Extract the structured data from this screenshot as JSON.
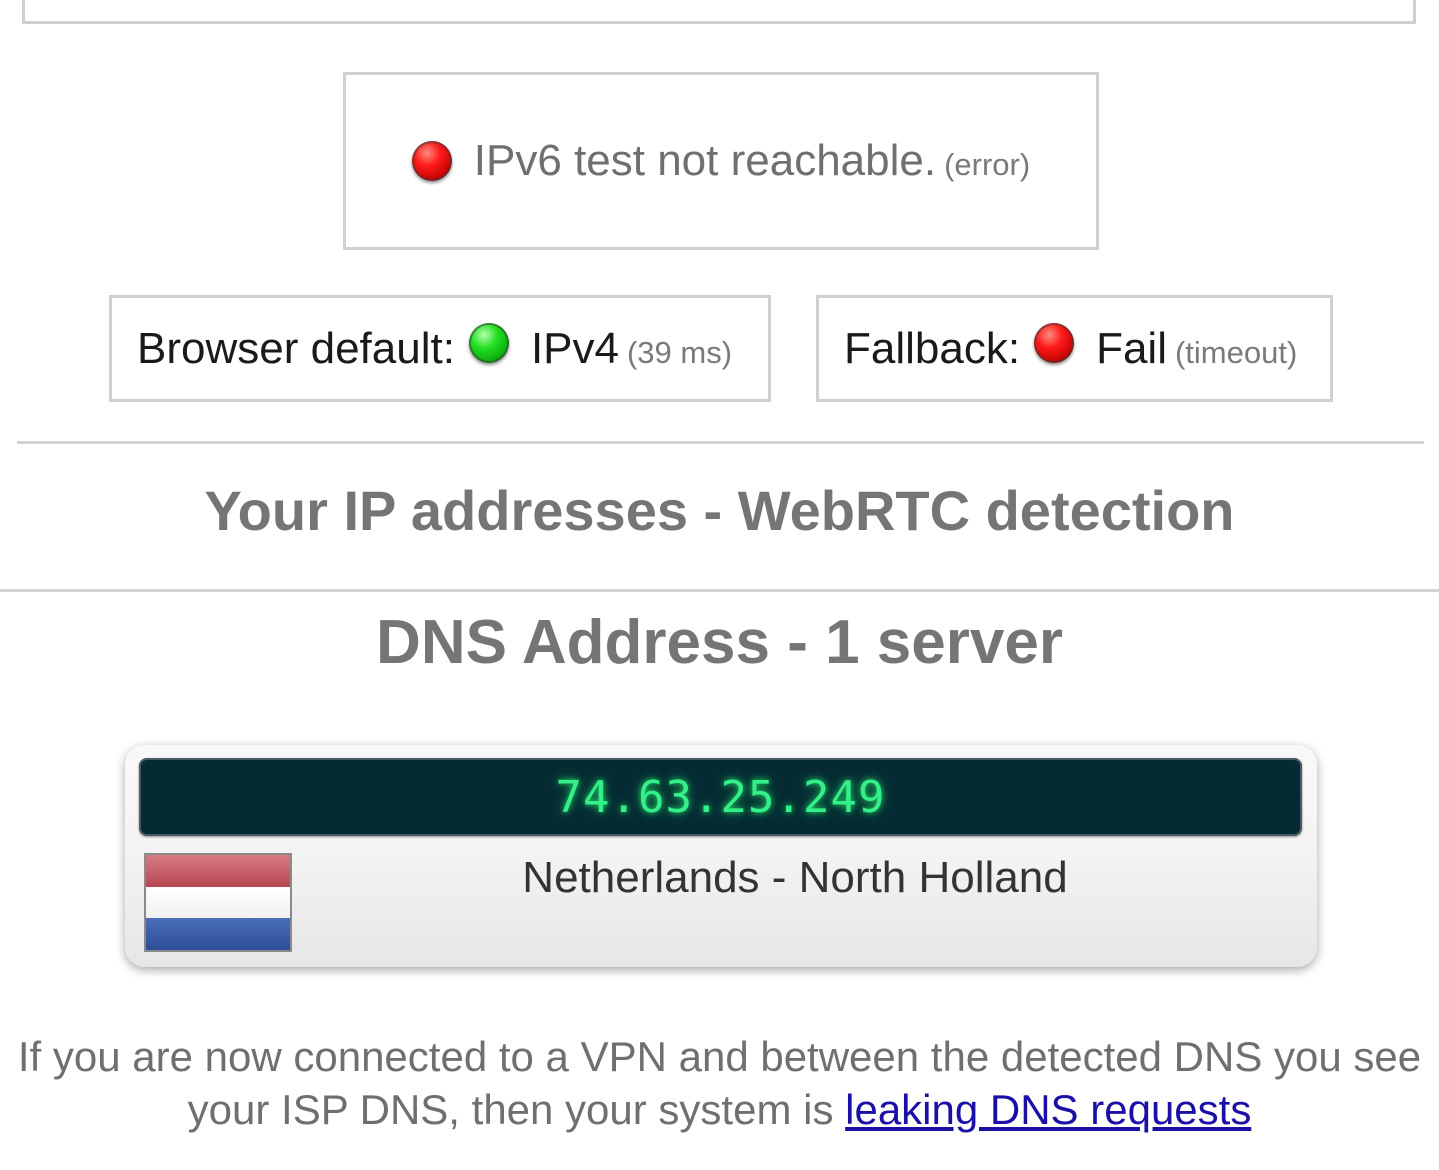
{
  "ipv6_test": {
    "status_color": "#ff1a1a",
    "message": "IPv6 test not reachable.",
    "note": "(error)"
  },
  "browser_default": {
    "label": "Browser default:",
    "status_color": "#22e022",
    "value": "IPv4",
    "note": "(39 ms)"
  },
  "fallback": {
    "label": "Fallback:",
    "status_color": "#ff1a1a",
    "value": "Fail",
    "note": "(timeout)"
  },
  "webrtc": {
    "title": "Your IP addresses - WebRTC detection"
  },
  "dns": {
    "title": "DNS Address - 1 server",
    "servers": [
      {
        "ip": "74.63.25.249",
        "location": "Netherlands - North Holland",
        "flag": "netherlands-flag"
      }
    ]
  },
  "footer": {
    "text": "If you are now connected to a VPN and between the detected DNS you see your ISP DNS, then your system is",
    "link_text": "leaking DNS requests"
  }
}
